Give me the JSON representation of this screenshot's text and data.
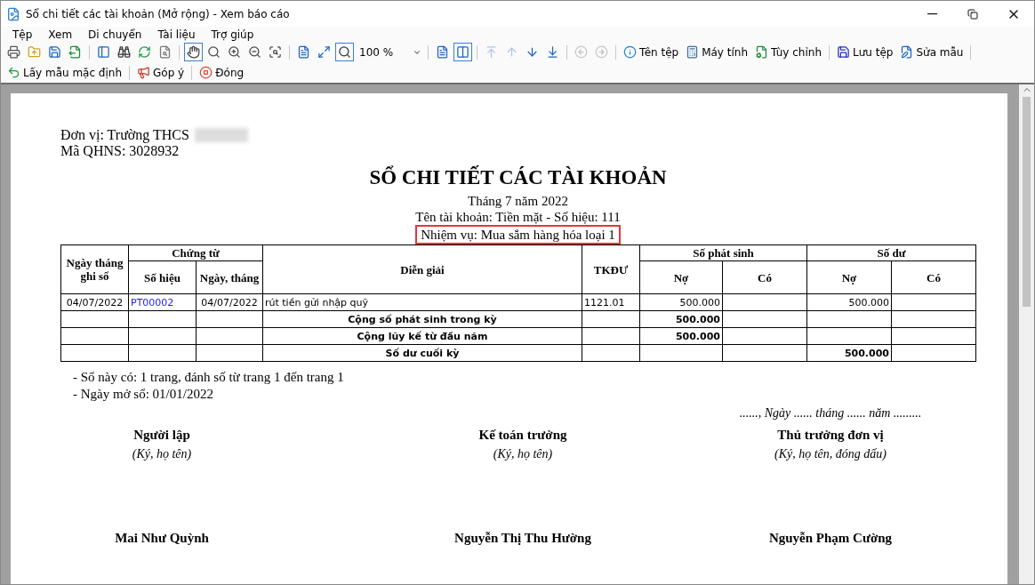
{
  "window": {
    "title": "Sổ chi tiết các tài khoản (Mở rộng) - Xem báo cáo"
  },
  "menu": [
    "Tệp",
    "Xem",
    "Di chuyển",
    "Tài liệu",
    "Trợ giúp"
  ],
  "toolbar": [
    {
      "kind": "icon",
      "selected": false,
      "disabled": false
    },
    {
      "kind": "icon",
      "selected": false,
      "disabled": false
    },
    {
      "kind": "icon",
      "selected": false,
      "disabled": false
    },
    {
      "kind": "icon",
      "selected": false,
      "disabled": false
    },
    {
      "kind": "separator"
    },
    {
      "kind": "icon",
      "selected": false,
      "disabled": false
    },
    {
      "kind": "icon",
      "selected": false,
      "disabled": false
    },
    {
      "kind": "icon",
      "selected": false,
      "disabled": false
    },
    {
      "kind": "icon",
      "selected": false,
      "disabled": false
    },
    {
      "kind": "separator"
    },
    {
      "kind": "icon",
      "selected": true,
      "disabled": false
    },
    {
      "kind": "icon",
      "selected": false,
      "disabled": false
    },
    {
      "kind": "icon",
      "selected": false,
      "disabled": false
    },
    {
      "kind": "icon",
      "selected": false,
      "disabled": false
    },
    {
      "kind": "icon",
      "selected": false,
      "disabled": false
    },
    {
      "kind": "separator"
    },
    {
      "kind": "icon",
      "selected": false,
      "disabled": false
    },
    {
      "kind": "icon",
      "selected": false,
      "disabled": false
    },
    {
      "kind": "icon",
      "selected": true,
      "disabled": false
    },
    {
      "kind": "select",
      "value": "100 %"
    },
    {
      "kind": "separator"
    },
    {
      "kind": "icon",
      "selected": false,
      "disabled": false
    },
    {
      "kind": "icon",
      "selected": true,
      "disabled": false
    },
    {
      "kind": "separator"
    },
    {
      "kind": "icon",
      "selected": false,
      "disabled": true
    },
    {
      "kind": "icon",
      "selected": false,
      "disabled": true
    },
    {
      "kind": "icon",
      "selected": false,
      "disabled": false
    },
    {
      "kind": "icon",
      "selected": false,
      "disabled": false
    },
    {
      "kind": "separator"
    },
    {
      "kind": "icon",
      "selected": false,
      "disabled": true
    },
    {
      "kind": "icon",
      "selected": false,
      "disabled": true
    },
    {
      "kind": "separator"
    },
    {
      "kind": "button",
      "label": "Tên tệp"
    },
    {
      "kind": "button",
      "label": "Máy tính"
    },
    {
      "kind": "button",
      "label": "Tùy chỉnh"
    },
    {
      "kind": "separator"
    },
    {
      "kind": "button",
      "label": "Lưu tệp"
    },
    {
      "kind": "button",
      "label": "Sửa mẫu"
    },
    {
      "kind": "separator"
    }
  ],
  "toolbar2": [
    {
      "kind": "button",
      "label": "Lấy mẫu mặc định"
    },
    {
      "kind": "separator"
    },
    {
      "kind": "button",
      "label": "Góp ý"
    },
    {
      "kind": "separator"
    },
    {
      "kind": "button",
      "label": "Đóng"
    }
  ],
  "report": {
    "unit": "Đơn vị: Trường THCS",
    "code": "Mã QHNS: 3028932",
    "title": "SỔ CHI TIẾT CÁC TÀI KHOẢN",
    "period": "Tháng 7 năm 2022",
    "account": "Tên tài khoản: Tiền mặt - Số hiệu: 111",
    "task": {
      "text": "Nhiệm vụ: Mua sắm hàng hóa loại 1",
      "highlighted": true
    },
    "columns": {
      "date": "Ngày tháng ghi sổ",
      "voucher": "Chứng từ",
      "voucher_no": "Số hiệu",
      "voucher_date": "Ngày, tháng",
      "description": "Diễn giải",
      "contra": "TKĐƯ",
      "turnover": {
        "label": "Số phát sinh",
        "debit": "Nợ",
        "credit": "Có"
      },
      "balance": {
        "label": "Số dư",
        "debit": "Nợ",
        "credit": "Có"
      }
    },
    "rows": [
      {
        "kind": "entry",
        "date": "04/07/2022",
        "voucher_no": "PT00002",
        "voucher_date": "04/07/2022",
        "description": "rút tiền gửi nhập quỹ",
        "contra": "1121.01",
        "turnover_debit": "500.000",
        "balance_debit": "500.000"
      },
      {
        "kind": "total",
        "description": "Cộng số phát sinh trong kỳ",
        "turnover_debit": "500.000"
      },
      {
        "kind": "total",
        "description": "Cộng lũy kế từ đầu năm",
        "turnover_debit": "500.000"
      },
      {
        "kind": "total",
        "description": "Số dư cuối kỳ",
        "balance_debit": "500.000"
      }
    ],
    "notes": [
      "- Sổ này có: 1 trang, đánh số từ trang 1 đến trang 1",
      "- Ngày mở sổ: 01/01/2022"
    ],
    "date_line": "......, Ngày ...... tháng ...... năm .........",
    "signatures": [
      {
        "role": "Người lập",
        "hint": "(Ký, họ tên)",
        "name": "Mai Như Quỳnh"
      },
      {
        "role": "Kế toán trưởng",
        "hint": "(Ký, họ tên)",
        "name": "Nguyễn Thị Thu Hường"
      },
      {
        "role": "Thủ trưởng đơn vị",
        "hint": "(Ký, họ tên, đóng dấu)",
        "name": "Nguyễn Phạm Cường"
      }
    ]
  }
}
